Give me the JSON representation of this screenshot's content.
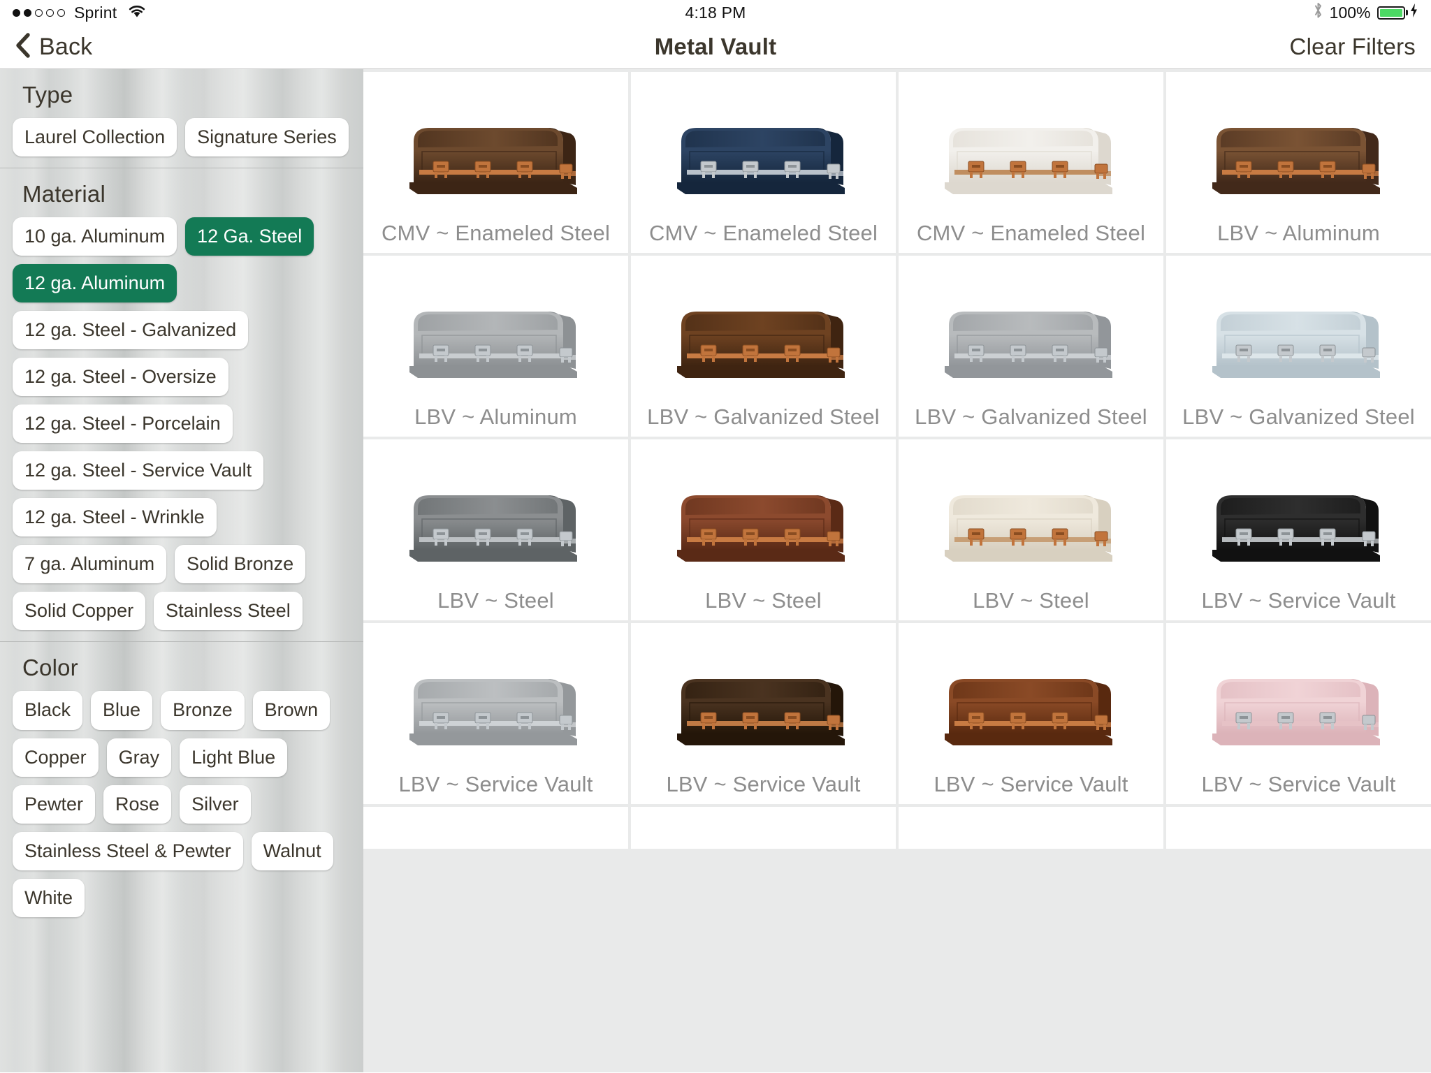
{
  "status_bar": {
    "carrier": "Sprint",
    "signal_dots_total": 5,
    "signal_dots_filled": 2,
    "wifi_icon": "wifi-icon",
    "time": "4:18 PM",
    "bluetooth_icon": "bluetooth-icon",
    "battery_percent": "100%",
    "battery_level": 100,
    "battery_color": "#4CD964",
    "charging_icon": "lightning-bolt-icon"
  },
  "nav_bar": {
    "back_icon": "chevron-left-icon",
    "back_label": "Back",
    "title": "Metal Vault",
    "clear_filters_label": "Clear Filters"
  },
  "sidebar": {
    "sections": [
      {
        "title": "Type",
        "options": [
          {
            "label": "Laurel Collection",
            "selected": false
          },
          {
            "label": "Signature Series",
            "selected": false
          }
        ]
      },
      {
        "title": "Material",
        "options": [
          {
            "label": "10 ga. Aluminum",
            "selected": false
          },
          {
            "label": "12 Ga. Steel",
            "selected": true
          },
          {
            "label": "12 ga. Aluminum",
            "selected": true
          },
          {
            "label": "12 ga. Steel - Galvanized",
            "selected": false
          },
          {
            "label": "12 ga. Steel - Oversize",
            "selected": false
          },
          {
            "label": "12 ga. Steel - Porcelain",
            "selected": false
          },
          {
            "label": "12 ga. Steel - Service Vault",
            "selected": false
          },
          {
            "label": "12 ga. Steel - Wrinkle",
            "selected": false
          },
          {
            "label": "7 ga. Aluminum",
            "selected": false
          },
          {
            "label": "Solid Bronze",
            "selected": false
          },
          {
            "label": "Solid Copper",
            "selected": false
          },
          {
            "label": "Stainless Steel",
            "selected": false
          }
        ]
      },
      {
        "title": "Color",
        "options": [
          {
            "label": "Black",
            "selected": false
          },
          {
            "label": "Blue",
            "selected": false
          },
          {
            "label": "Bronze",
            "selected": false
          },
          {
            "label": "Brown",
            "selected": false
          },
          {
            "label": "Copper",
            "selected": false
          },
          {
            "label": "Gray",
            "selected": false
          },
          {
            "label": "Light Blue",
            "selected": false
          },
          {
            "label": "Pewter",
            "selected": false
          },
          {
            "label": "Rose",
            "selected": false
          },
          {
            "label": "Silver",
            "selected": false
          },
          {
            "label": "Stainless Steel & Pewter",
            "selected": false
          },
          {
            "label": "Walnut",
            "selected": false
          },
          {
            "label": "White",
            "selected": false
          }
        ]
      }
    ],
    "selected_color": "#137a55"
  },
  "results_grid": {
    "items": [
      {
        "caption": "CMV ~ Enameled Steel",
        "body": "#6d4a2e",
        "body2": "#3c2515",
        "trim": "#c87b43",
        "hardware": "copper"
      },
      {
        "caption": "CMV ~ Enameled Steel",
        "body": "#2d4463",
        "body2": "#15263c",
        "trim": "#b9c2cb",
        "hardware": "silver"
      },
      {
        "caption": "CMV ~ Enameled Steel",
        "body": "#f2f0ec",
        "body2": "#ddd8cf",
        "trim": "#c08e60",
        "hardware": "copper"
      },
      {
        "caption": "LBV ~ Aluminum",
        "body": "#7a5334",
        "body2": "#42291a",
        "trim": "#c87b43",
        "hardware": "copper"
      },
      {
        "caption": "LBV ~ Aluminum",
        "body": "#b3b6b8",
        "body2": "#8d9194",
        "trim": "#c9cdd0",
        "hardware": "silver"
      },
      {
        "caption": "LBV ~ Galvanized Steel",
        "body": "#6e4221",
        "body2": "#3f2411",
        "trim": "#c87b43",
        "hardware": "copper"
      },
      {
        "caption": "LBV ~ Galvanized Steel",
        "body": "#b8bbbd",
        "body2": "#92969a",
        "trim": "#ccd0d3",
        "hardware": "silver"
      },
      {
        "caption": "LBV ~ Galvanized Steel",
        "body": "#d7e1e6",
        "body2": "#b4c2ca",
        "trim": "#dde6ea",
        "hardware": "silver"
      },
      {
        "caption": "LBV ~ Steel",
        "body": "#8b8e90",
        "body2": "#5e6365",
        "trim": "#bcc0c3",
        "hardware": "silver"
      },
      {
        "caption": "LBV ~ Steel",
        "body": "#8c4a2e",
        "body2": "#5a2a16",
        "trim": "#c87b43",
        "hardware": "copper"
      },
      {
        "caption": "LBV ~ Steel",
        "body": "#efe9dd",
        "body2": "#d8d0c0",
        "trim": "#c79f76",
        "hardware": "copper"
      },
      {
        "caption": "LBV ~ Service Vault",
        "body": "#2e2e2e",
        "body2": "#111111",
        "trim": "#b6babd",
        "hardware": "silver"
      },
      {
        "caption": "LBV ~ Service Vault",
        "body": "#bcbfc1",
        "body2": "#94989b",
        "trim": "#ced2d5",
        "hardware": "silver"
      },
      {
        "caption": "LBV ~ Service Vault",
        "body": "#4a3320",
        "body2": "#241609",
        "trim": "#c07a45",
        "hardware": "copper"
      },
      {
        "caption": "LBV ~ Service Vault",
        "body": "#8a4a26",
        "body2": "#59290f",
        "trim": "#c87b43",
        "hardware": "copper"
      },
      {
        "caption": "LBV ~ Service Vault",
        "body": "#f0d3d6",
        "body2": "#dcb3b9",
        "trim": "#e6c2c6",
        "hardware": "silver"
      }
    ],
    "partial_row_visible": true
  }
}
